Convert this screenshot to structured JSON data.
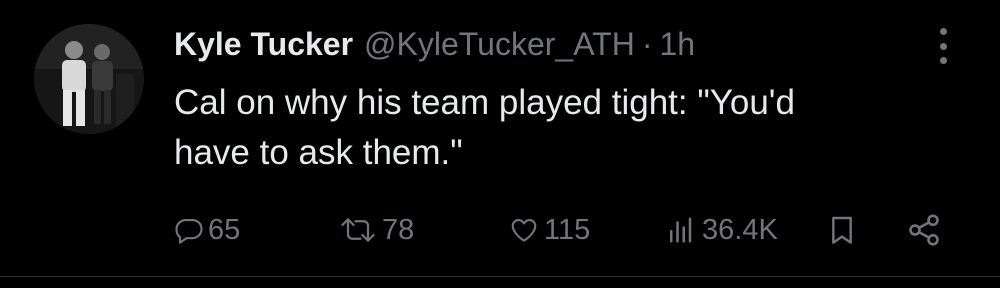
{
  "post": {
    "author": {
      "display_name": "Kyle Tucker",
      "handle": "@KyleTucker_ATH"
    },
    "separator": "·",
    "timestamp": "1h",
    "text_line1": "Cal on why his team played tight: \"You'd",
    "text_line2": "have to ask them.\""
  },
  "actions": {
    "replies": "65",
    "reposts": "78",
    "likes": "115",
    "views": "36.4K"
  },
  "colors": {
    "background": "#000000",
    "primary_text": "#e7e9ea",
    "secondary_text": "#71767b",
    "divider": "#2f3336"
  },
  "icons": [
    "more-icon",
    "reply-icon",
    "repost-icon",
    "like-icon",
    "views-icon",
    "bookmark-icon",
    "share-icon"
  ]
}
